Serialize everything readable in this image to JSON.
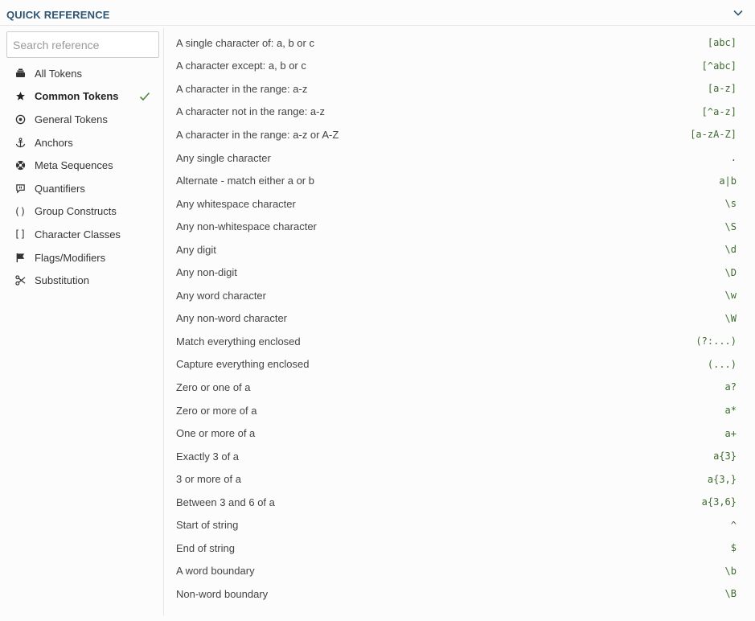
{
  "header": {
    "title": "QUICK REFERENCE"
  },
  "search": {
    "placeholder": "Search reference"
  },
  "sidebar": {
    "items": [
      {
        "label": "All Tokens",
        "icon": "stack-icon",
        "active": false
      },
      {
        "label": "Common Tokens",
        "icon": "star-icon",
        "active": true
      },
      {
        "label": "General Tokens",
        "icon": "target-icon",
        "active": false
      },
      {
        "label": "Anchors",
        "icon": "anchor-icon",
        "active": false
      },
      {
        "label": "Meta Sequences",
        "icon": "life-ring-icon",
        "active": false
      },
      {
        "label": "Quantifiers",
        "icon": "speech-bubble-icon",
        "active": false
      },
      {
        "label": "Group Constructs",
        "icon": "parentheses-icon",
        "active": false
      },
      {
        "label": "Character Classes",
        "icon": "brackets-icon",
        "active": false
      },
      {
        "label": "Flags/Modifiers",
        "icon": "flag-icon",
        "active": false
      },
      {
        "label": "Substitution",
        "icon": "scissors-icon",
        "active": false
      }
    ]
  },
  "tokens": [
    {
      "desc": "A single character of: a, b or c",
      "token": "[abc]"
    },
    {
      "desc": "A character except: a, b or c",
      "token": "[^abc]"
    },
    {
      "desc": "A character in the range: a-z",
      "token": "[a-z]"
    },
    {
      "desc": "A character not in the range: a-z",
      "token": "[^a-z]"
    },
    {
      "desc": "A character in the range: a-z or A-Z",
      "token": "[a-zA-Z]"
    },
    {
      "desc": "Any single character",
      "token": "."
    },
    {
      "desc": "Alternate - match either a or b",
      "token": "a|b"
    },
    {
      "desc": "Any whitespace character",
      "token": "\\s"
    },
    {
      "desc": "Any non-whitespace character",
      "token": "\\S"
    },
    {
      "desc": "Any digit",
      "token": "\\d"
    },
    {
      "desc": "Any non-digit",
      "token": "\\D"
    },
    {
      "desc": "Any word character",
      "token": "\\w"
    },
    {
      "desc": "Any non-word character",
      "token": "\\W"
    },
    {
      "desc": "Match everything enclosed",
      "token": "(?:...)"
    },
    {
      "desc": "Capture everything enclosed",
      "token": "(...)"
    },
    {
      "desc": "Zero or one of a",
      "token": "a?"
    },
    {
      "desc": "Zero or more of a",
      "token": "a*"
    },
    {
      "desc": "One or more of a",
      "token": "a+"
    },
    {
      "desc": "Exactly 3 of a",
      "token": "a{3}"
    },
    {
      "desc": "3 or more of a",
      "token": "a{3,}"
    },
    {
      "desc": "Between 3 and 6 of a",
      "token": "a{3,6}"
    },
    {
      "desc": "Start of string",
      "token": "^"
    },
    {
      "desc": "End of string",
      "token": "$"
    },
    {
      "desc": "A word boundary",
      "token": "\\b"
    },
    {
      "desc": "Non-word boundary",
      "token": "\\B"
    }
  ],
  "colors": {
    "header": "#2e5674",
    "token": "#3d6b2f",
    "check": "#4a8a3a"
  }
}
